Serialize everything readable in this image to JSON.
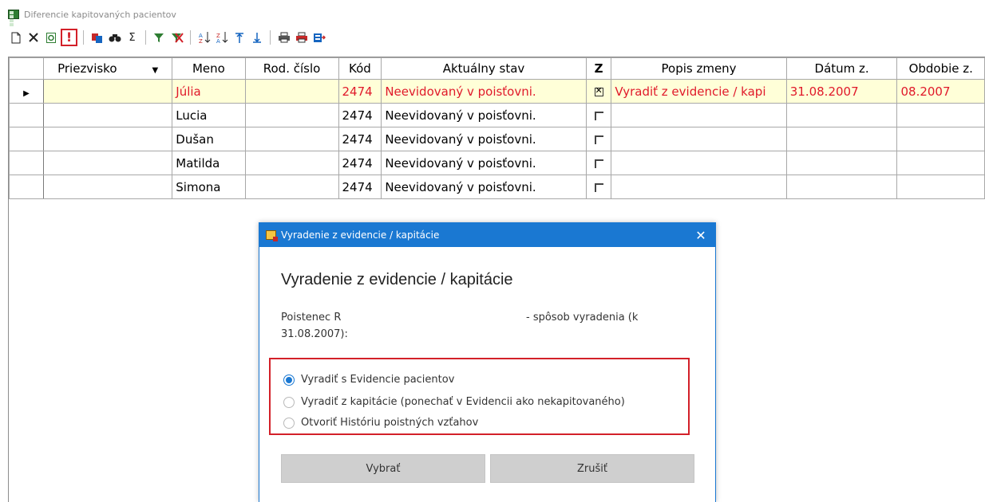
{
  "window": {
    "title": "Diferencie kapitovaných pacientov"
  },
  "toolbar": {
    "icons": [
      "new-icon",
      "delete-icon",
      "refresh-icon",
      "alert-icon",
      "select-icon",
      "find-icon",
      "sum-icon",
      "filter-icon",
      "clear-filter-icon",
      "sort-asc-icon",
      "sort-desc-icon",
      "top-icon",
      "bottom-icon",
      "print-icon",
      "print-preview-icon",
      "export-icon"
    ],
    "highlight_color": "#d32029"
  },
  "grid": {
    "columns": [
      "Priezvisko",
      "Meno",
      "Rod. číslo",
      "Kód",
      "Aktuálny stav",
      "Z",
      "Popis zmeny",
      "Dátum z.",
      "Obdobie z."
    ],
    "rows": [
      {
        "priezvisko": "",
        "meno": "Júlia",
        "rod_cislo": "",
        "kod": "2474",
        "stav": "Neevidovaný v poisťovni.",
        "z": true,
        "popis": "Vyradiť z evidencie / kapi",
        "datum": "31.08.2007",
        "obdobie": "08.2007",
        "selected": true
      },
      {
        "priezvisko": "",
        "meno": "Lucia",
        "rod_cislo": "",
        "kod": "2474",
        "stav": "Neevidovaný v poisťovni.",
        "z": false,
        "popis": "",
        "datum": "",
        "obdobie": ""
      },
      {
        "priezvisko": "",
        "meno": "Dušan",
        "rod_cislo": "",
        "kod": "2474",
        "stav": "Neevidovaný v poisťovni.",
        "z": false,
        "popis": "",
        "datum": "",
        "obdobie": ""
      },
      {
        "priezvisko": "",
        "meno": "Matilda",
        "rod_cislo": "",
        "kod": "2474",
        "stav": "Neevidovaný v poisťovni.",
        "z": false,
        "popis": "",
        "datum": "",
        "obdobie": ""
      },
      {
        "priezvisko": "",
        "meno": "Simona",
        "rod_cislo": "",
        "kod": "2474",
        "stav": "Neevidovaný v poisťovni.",
        "z": false,
        "popis": "",
        "datum": "",
        "obdobie": ""
      }
    ],
    "selected_text_color": "#e0192a",
    "selected_row_bg": "#ffffd8"
  },
  "dialog": {
    "title": "Vyradenie z evidencie / kapitácie",
    "heading": "Vyradenie z evidencie / kapitácie",
    "info_line1": "Poistenec R",
    "info_line2": "31.08.2007):",
    "info_line3": "- spôsob vyradenia (k",
    "options": [
      {
        "label": "Vyradiť s Evidencie pacientov",
        "selected": true
      },
      {
        "label": "Vyradiť z kapitácie (ponechať v Evidencii ako nekapitovaného)",
        "selected": false
      },
      {
        "label": "Otvoriť Históriu poistných vzťahov",
        "selected": false
      }
    ],
    "buttons": {
      "ok": "Vybrať",
      "cancel": "Zrušiť"
    },
    "accent_color": "#1a78d2"
  }
}
